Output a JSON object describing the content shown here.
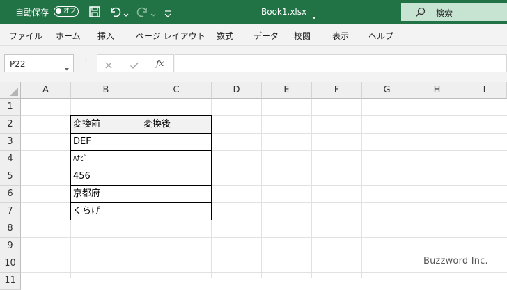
{
  "titlebar": {
    "autosave_label": "自動保存",
    "autosave_state": "オフ",
    "filename": "Book1.xlsx",
    "search_label": "検索"
  },
  "ribbon": {
    "tabs": [
      "ファイル",
      "ホーム",
      "挿入",
      "ページ レイアウト",
      "数式",
      "データ",
      "校閲",
      "表示",
      "ヘルプ"
    ]
  },
  "formula_bar": {
    "name_box": "P22",
    "fx_label": "fx",
    "formula": ""
  },
  "sheet": {
    "columns": [
      "A",
      "B",
      "C",
      "D",
      "E",
      "F",
      "G",
      "H",
      "I"
    ],
    "rows": [
      "1",
      "2",
      "3",
      "4",
      "5",
      "6",
      "7",
      "8",
      "9",
      "10",
      "11"
    ],
    "table": {
      "header": [
        "変換前",
        "変換後"
      ],
      "values": [
        "DEF",
        "ﾊﾅﾋﾞ",
        "456",
        "京都府",
        "くらげ"
      ]
    }
  },
  "watermark": "Buzzword Inc.",
  "colors": {
    "titlebar": "#217346",
    "search_box": "#c7e4d2",
    "ribbon": "#f3f3f3",
    "header_fill": "#efefef",
    "gridline": "#e1e1e1"
  }
}
